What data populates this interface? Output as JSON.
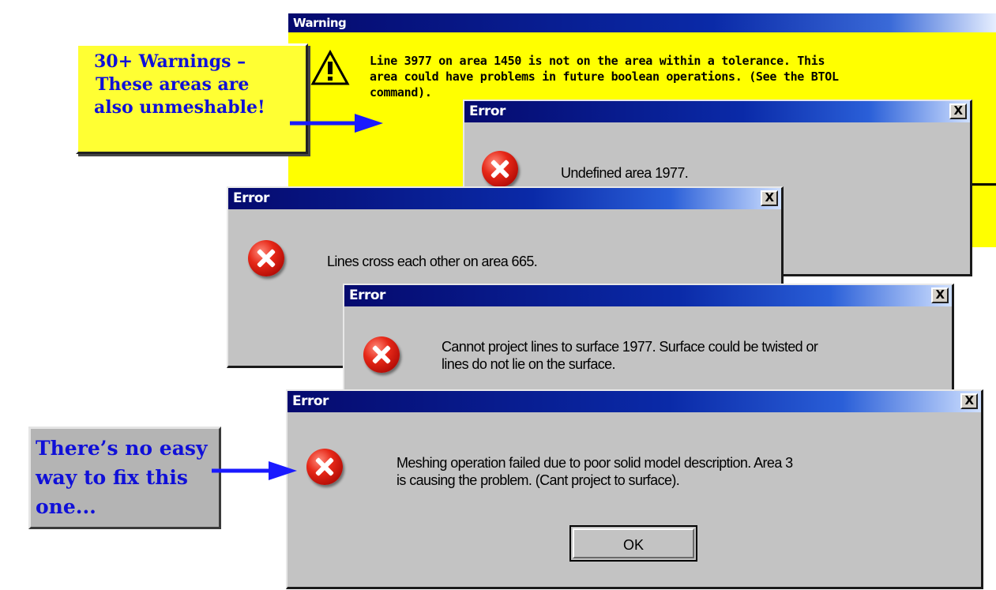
{
  "warning_dialog": {
    "title": "Warning",
    "icon": "warning-icon",
    "message_lines": [
      "Line 3977 on area 1450 is not on the area within a tolerance.  This",
      "area could have problems in future boolean operations.  (See the BTOL",
      "command)."
    ]
  },
  "error_dialogs": [
    {
      "title": "Error",
      "close_label": "X",
      "icon": "error-icon",
      "message_lines": [
        "Undefined area 1977."
      ]
    },
    {
      "title": "Error",
      "close_label": "X",
      "icon": "error-icon",
      "message_lines": [
        "Lines cross each other on area 665."
      ]
    },
    {
      "title": "Error",
      "close_label": "X",
      "icon": "error-icon",
      "message_lines": [
        "Cannot project lines to surface 1977.  Surface could be twisted or",
        "lines do not lie on the surface."
      ]
    },
    {
      "title": "Error",
      "close_label": "X",
      "icon": "error-icon",
      "message_lines": [
        "Meshing operation failed due to poor solid model description.  Area 3",
        "is causing the problem.  (Cant project to surface)."
      ],
      "ok_label": "OK"
    }
  ],
  "callouts": {
    "warnings_note": [
      "30+ Warnings –",
      "These areas are",
      "also unmeshable!"
    ],
    "fix_note": [
      "There’s no easy",
      "way to fix this",
      "one..."
    ]
  },
  "colors": {
    "warning_background": "#ffff00",
    "titlebar_dark": "#050a6e",
    "callout_text": "#1010d8",
    "arrow": "#1a1aff",
    "dialog_face": "#c3c3c3"
  }
}
